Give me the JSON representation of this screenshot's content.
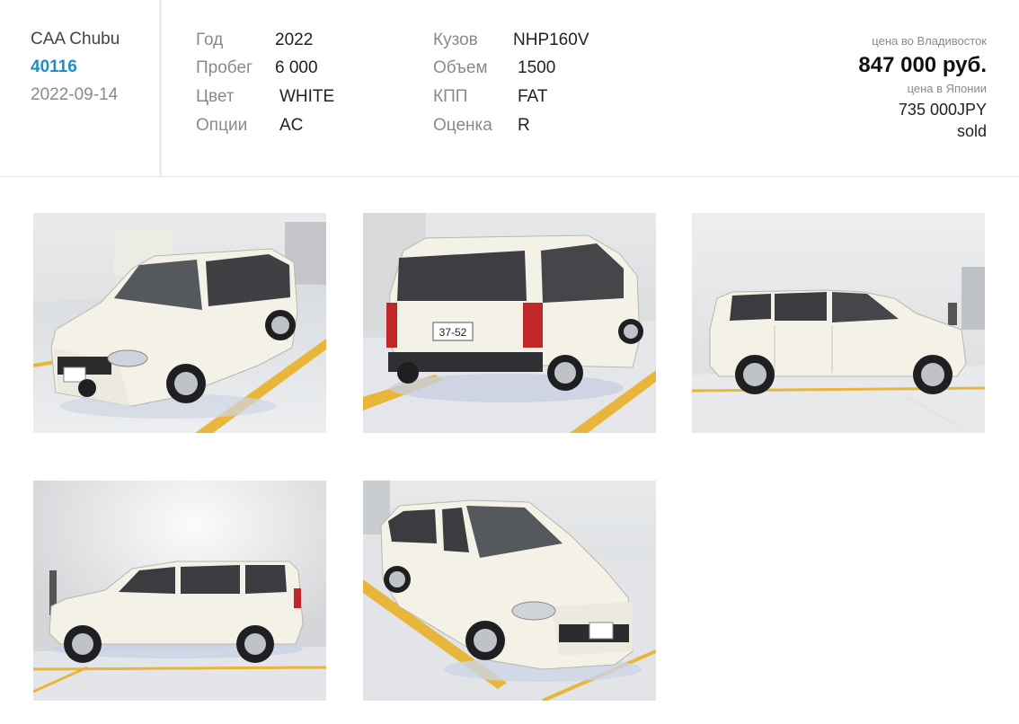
{
  "lot": {
    "auction": "CAA Chubu",
    "number": "40116",
    "date": "2022-09-14"
  },
  "specs": [
    {
      "label": "Год",
      "value": "2022"
    },
    {
      "label": "Пробег",
      "value": "6 000"
    },
    {
      "label": "Цвет",
      "value": "WHITE"
    },
    {
      "label": "Опции",
      "value": "AC"
    },
    {
      "label": "Кузов",
      "value": "NHP160V"
    },
    {
      "label": "Объем",
      "value": "1500"
    },
    {
      "label": "КПП",
      "value": "FAT"
    },
    {
      "label": "Оценка",
      "value": "R"
    }
  ],
  "price": {
    "vladivostok_label": "цена во Владивосток",
    "vladivostok_value": "847 000 руб.",
    "japan_label": "цена в Японии",
    "japan_value": "735 000JPY",
    "status": "sold"
  },
  "photos": [
    {
      "view": "front-left"
    },
    {
      "view": "rear"
    },
    {
      "view": "right-side"
    },
    {
      "view": "left-side"
    },
    {
      "view": "front-right"
    }
  ],
  "colors": {
    "lot_number": "#1f8fc7",
    "car_body": "#f4f1e6",
    "floor_line": "#e8b63a"
  }
}
